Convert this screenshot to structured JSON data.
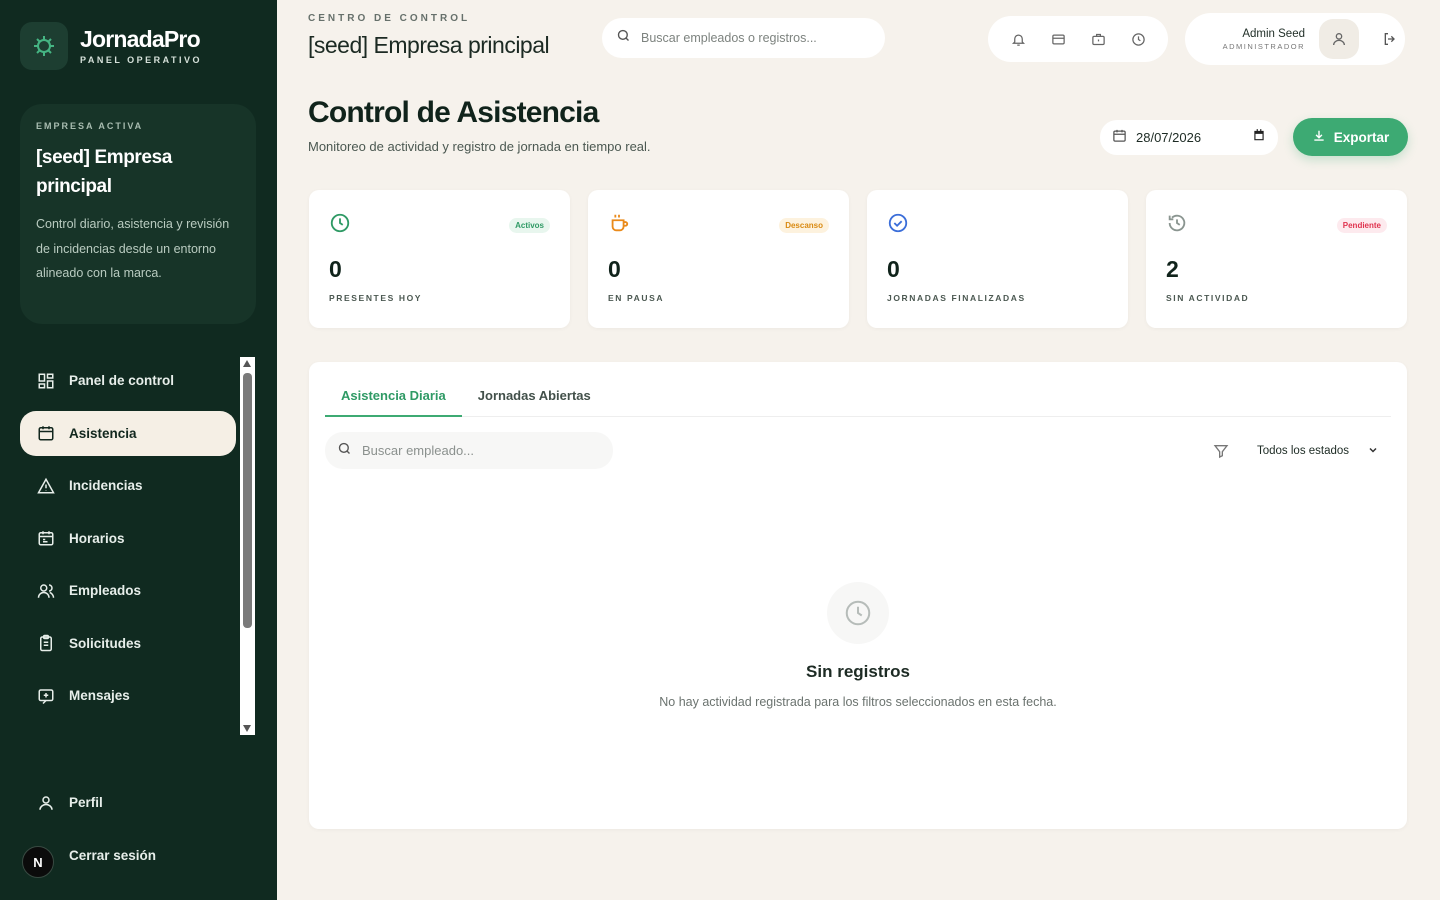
{
  "brand": {
    "name": "JornadaPro",
    "subtitle": "PANEL OPERATIVO"
  },
  "company_card": {
    "kicker": "EMPRESA ACTIVA",
    "name": "[seed] Empresa principal",
    "description": "Control diario, asistencia y revisión de incidencias desde un entorno alineado con la marca."
  },
  "sidebar": {
    "items": [
      {
        "label": "Panel de control",
        "icon": "dashboard-icon"
      },
      {
        "label": "Asistencia",
        "icon": "calendar-icon",
        "active": true
      },
      {
        "label": "Incidencias",
        "icon": "alert-triangle-icon"
      },
      {
        "label": "Horarios",
        "icon": "schedule-icon"
      },
      {
        "label": "Empleados",
        "icon": "users-icon"
      },
      {
        "label": "Solicitudes",
        "icon": "clipboard-icon"
      },
      {
        "label": "Mensajes",
        "icon": "message-icon"
      }
    ],
    "bottom": [
      {
        "label": "Perfil",
        "icon": "user-icon"
      },
      {
        "label": "Cerrar sesión",
        "icon": "logout-icon"
      }
    ],
    "avatar_letter": "N"
  },
  "topbar": {
    "kicker": "CENTRO DE CONTROL",
    "title": "[seed] Empresa principal",
    "search_placeholder": "Buscar empleados o registros...",
    "user_name": "Admin Seed",
    "user_role": "ADMINISTRADOR"
  },
  "page": {
    "title": "Control de Asistencia",
    "subtitle": "Monitoreo de actividad y registro de jornada en tiempo real.",
    "date": "28/07/2026",
    "export_label": "Exportar"
  },
  "stats": [
    {
      "value": "0",
      "label": "PRESENTES HOY",
      "badge": "Activos",
      "badge_color": "#2f9a65",
      "badge_bg": "#e8f6ee",
      "icon": "clock-icon",
      "icon_color": "#2f9a65"
    },
    {
      "value": "0",
      "label": "EN PAUSA",
      "badge": "Descanso",
      "badge_color": "#d98a12",
      "badge_bg": "#fdf2de",
      "icon": "coffee-icon",
      "icon_color": "#ea8a1a"
    },
    {
      "value": "0",
      "label": "JORNADAS FINALIZADAS",
      "badge": "",
      "badge_color": "#3b6ed9",
      "badge_bg": "#ffffff",
      "icon": "check-circle-icon",
      "icon_color": "#3b6ed9"
    },
    {
      "value": "2",
      "label": "SIN ACTIVIDAD",
      "badge": "Pendiente",
      "badge_color": "#e0334f",
      "badge_bg": "#fdeaee",
      "icon": "history-icon",
      "icon_color": "#8a9590"
    }
  ],
  "panel": {
    "tabs": [
      "Asistencia Diaria",
      "Jornadas Abiertas"
    ],
    "search_placeholder": "Buscar empleado...",
    "status_filter": "Todos los estados",
    "empty_title": "Sin registros",
    "empty_desc": "No hay actividad registrada para los filtros seleccionados en esta fecha."
  },
  "colors": {
    "sidebar": "#102a20",
    "accent": "#3daa73",
    "background": "#f6f2ec"
  }
}
